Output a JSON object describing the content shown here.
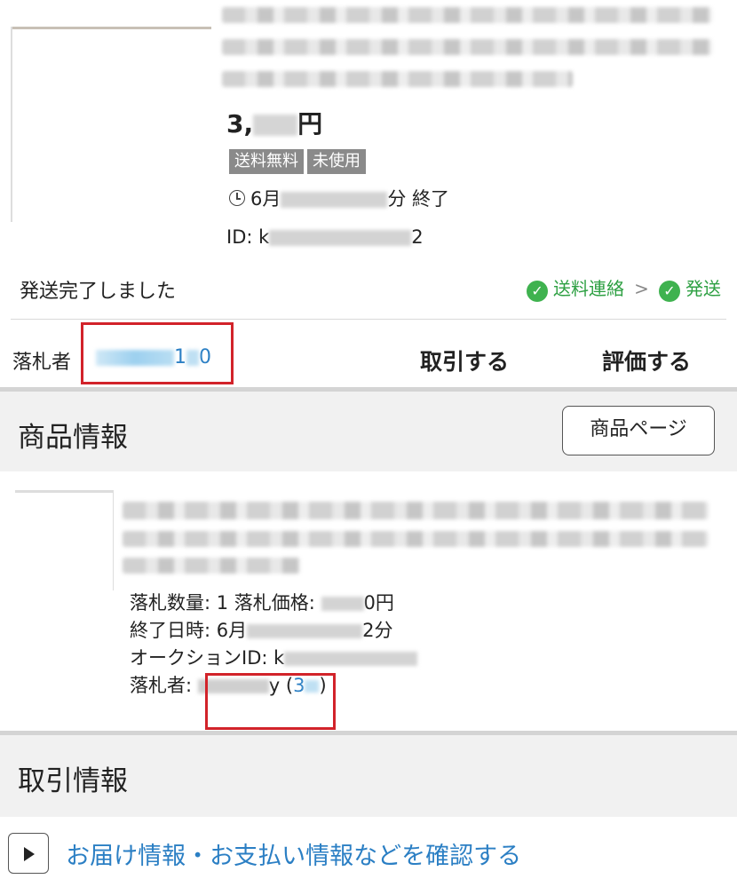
{
  "top_item": {
    "price_prefix": "3,",
    "price_suffix": "円",
    "badges": [
      "送料無料",
      "未使用"
    ],
    "end_prefix": "6月",
    "end_suffix": "分 終了",
    "id_prefix": "ID: k",
    "id_suffix": "2"
  },
  "status": {
    "message": "発送完了しました",
    "steps": [
      "送料連絡",
      "発送"
    ],
    "separator": ">"
  },
  "bidder_bar": {
    "label": "落札者",
    "username_tail": "1",
    "username_end": "0",
    "trade_button": "取引する",
    "rate_button": "評価する"
  },
  "product_section": {
    "title": "商品情報",
    "page_button": "商品ページ",
    "quantity_label": "落札数量: 1 落札価格: ",
    "price_suffix": "0円",
    "end_label": "終了日時: 6月",
    "end_suffix": "2分",
    "auction_id_label": "オークションID: k",
    "bidder_label": "落札者: ",
    "bidder_tail": "y",
    "rating_open": "(",
    "rating_value": "3",
    "rating_close": ")"
  },
  "trade_section": {
    "title": "取引情報",
    "expand_link": "お届け情報・お支払い情報などを確認する",
    "expand_icon": "play-triangle-icon"
  },
  "colors": {
    "accent_green": "#3fb24f",
    "link_blue": "#2b7fc4",
    "highlight_red": "#d2232a",
    "badge_gray": "#8a8a8a"
  }
}
